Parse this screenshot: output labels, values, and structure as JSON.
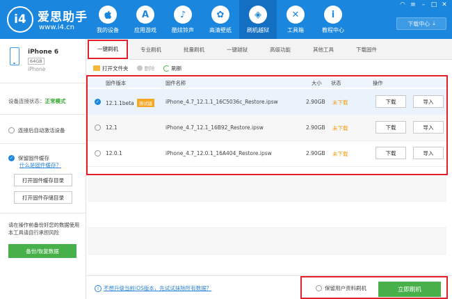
{
  "brand": {
    "logo": "i4",
    "title": "爱思助手",
    "url": "www.i4.cn"
  },
  "nav": [
    {
      "label": "我的设备",
      "icon": "apple-icon",
      "glyph": ""
    },
    {
      "label": "应用游戏",
      "icon": "appstore-icon",
      "glyph": "A"
    },
    {
      "label": "酷炫铃声",
      "icon": "bell-icon",
      "glyph": "♪"
    },
    {
      "label": "高清壁纸",
      "icon": "flower-icon",
      "glyph": "✿"
    },
    {
      "label": "刷机越狱",
      "icon": "box-icon",
      "glyph": "◈"
    },
    {
      "label": "工具箱",
      "icon": "tools-icon",
      "glyph": "✕"
    },
    {
      "label": "教程中心",
      "icon": "info-icon",
      "glyph": "i"
    }
  ],
  "window": {
    "download_center": "下载中心",
    "download_glyph": "⤓"
  },
  "device": {
    "name": "iPhone 6",
    "capacity": "64GB",
    "type": "iPhone"
  },
  "sidebar": {
    "status_label": "设备连接状态：",
    "status_value": "正常模式",
    "auto_activate": "连接后自动激活设备",
    "keep_cache": "保留固件缓存",
    "what_cache": "什么是固件缓存？",
    "open_cache_dir": "打开固件缓存目录",
    "open_storage_dir": "打开固件存储目录",
    "notice": "请在操作前备份好您的数据使用本工具请自行承担风险",
    "backup_button": "备份/恢复数据"
  },
  "tabs": [
    "一键刷机",
    "专业刷机",
    "批量刷机",
    "一键越狱",
    "高级功能",
    "其他工具",
    "下载固件"
  ],
  "toolbar": {
    "open_folder": "打开文件夹",
    "delete": "删除",
    "refresh": "刷新"
  },
  "table": {
    "headers": {
      "version": "固件版本",
      "name": "固件名称",
      "size": "大小",
      "state": "状态",
      "ops": "操作"
    },
    "rows": [
      {
        "version": "12.1.1beta",
        "tag": "测试版",
        "name": "iPhone_4.7_12.1.1_16C5036c_Restore.ipsw",
        "size": "2.90GB",
        "state": "未下载",
        "download": "下载",
        "import": "导入"
      },
      {
        "version": "12.1",
        "tag": "",
        "name": "iPhone_4.7_12.1_16B92_Restore.ipsw",
        "size": "2.90GB",
        "state": "未下载",
        "download": "下载",
        "import": "导入"
      },
      {
        "version": "12.0.1",
        "tag": "",
        "name": "iPhone_4.7_12.0.1_16A404_Restore.ipsw",
        "size": "2.90GB",
        "state": "未下载",
        "download": "下载",
        "import": "导入"
      }
    ]
  },
  "footer": {
    "link": "不想升级当前iOS版本，先试试抹除所有数据？",
    "keep_user_data": "保留用户资料刷机",
    "flash_button": "立即刷机"
  },
  "colors": {
    "header": "#1a86dd",
    "accent_green": "#47b04b",
    "highlight_red": "#e3202a",
    "warning": "#f39c12"
  }
}
